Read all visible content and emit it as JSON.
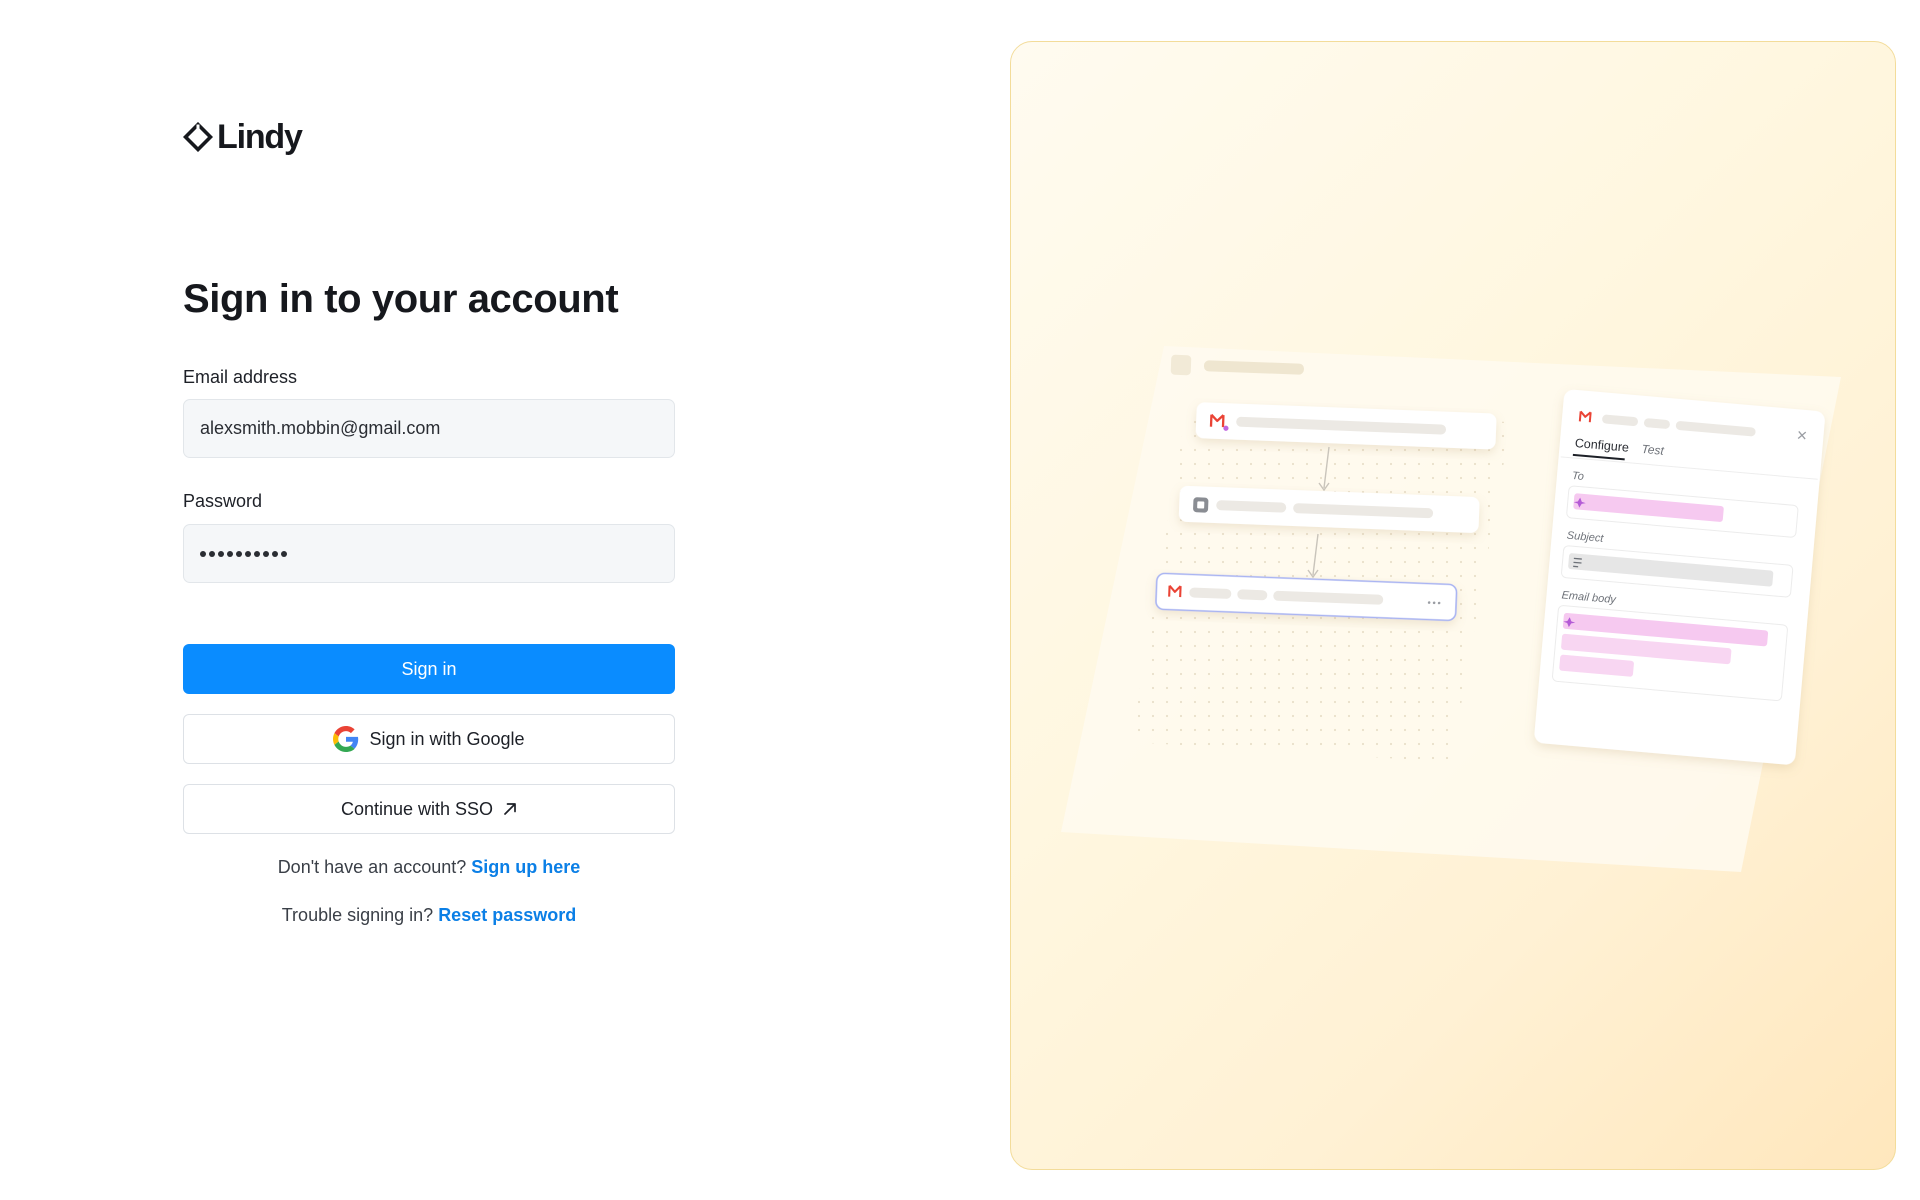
{
  "brand": {
    "name": "Lindy",
    "logo_icon": "diamond-chevron-icon"
  },
  "form": {
    "title": "Sign in to your account",
    "email_label": "Email address",
    "email_value": "alexsmith.mobbin@gmail.com",
    "password_label": "Password",
    "password_length": 10,
    "sign_in_label": "Sign in",
    "google_label": "Sign in with Google",
    "sso_label": "Continue with SSO"
  },
  "helpers": {
    "signup_prompt": "Don't have an account?",
    "signup_link": "Sign up here",
    "reset_prompt": "Trouble signing in?",
    "reset_link": "Reset password"
  },
  "illustration": {
    "tabs": [
      "Configure",
      "Test"
    ],
    "fields": [
      "To",
      "Subject",
      "Email body"
    ]
  },
  "colors": {
    "primary": "#0a8cff",
    "link": "#0b7fe6",
    "panel_border": "#f3dc9a",
    "accent_pink": "#f6c9f0"
  }
}
